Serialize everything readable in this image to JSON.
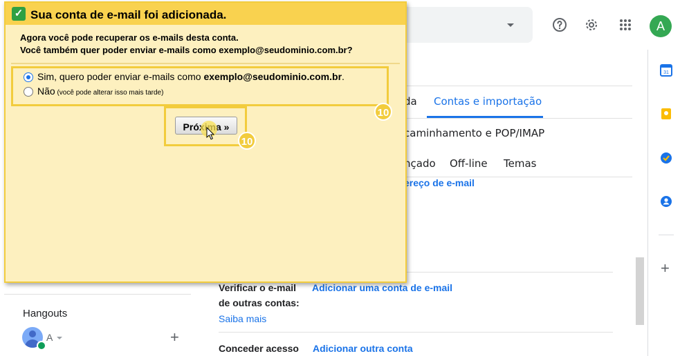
{
  "topbar": {
    "avatar_letter": "A",
    "help_icon": "help-circle-icon",
    "settings_icon": "gear-icon",
    "apps_icon": "apps-grid-icon"
  },
  "settings": {
    "tabs_row1": [
      {
        "label": "da",
        "active": false
      },
      {
        "label": "Contas e importação",
        "active": true
      }
    ],
    "tabs_row2": [
      "caminhamento e POP/IMAP"
    ],
    "tabs_row3": [
      "nçado",
      "Off-line",
      "Temas"
    ],
    "partial_link": "ereço de e-mail",
    "sections": [
      {
        "label_line1": "Verificar o e-mail",
        "label_line2": "de outras contas:",
        "action": "Adicionar uma conta de e-mail",
        "learn_more": "Saiba mais"
      },
      {
        "label_line1": "Conceder acesso",
        "action": "Adicionar outra conta"
      }
    ]
  },
  "side_panel": {
    "apps": [
      "calendar-icon",
      "keep-icon",
      "tasks-icon",
      "contacts-icon"
    ],
    "add_icon": "plus-icon"
  },
  "hangouts": {
    "title": "Hangouts",
    "user_initial": "A"
  },
  "dialog": {
    "title": "Sua conta de e-mail foi adicionada.",
    "line1": "Agora você pode recuperar os e-mails desta conta.",
    "line2": "Você também quer poder enviar e-mails como exemplo@seudominio.com.br?",
    "option_yes_prefix": "Sim, quero poder enviar e-mails como ",
    "option_yes_email": "exemplo@seudominio.com.br",
    "option_yes_suffix": ".",
    "option_no_label": "Não",
    "option_no_note": " (você pode alterar isso mais tarde)",
    "selected_option": "yes",
    "next_button": "Próxima »",
    "step_badges": [
      "10",
      "10"
    ]
  },
  "colors": {
    "accent": "#1a73e8",
    "dialog_bg": "#fdf0bf",
    "dialog_title_bg": "#f9d24f",
    "highlight": "#f2cc3d"
  }
}
